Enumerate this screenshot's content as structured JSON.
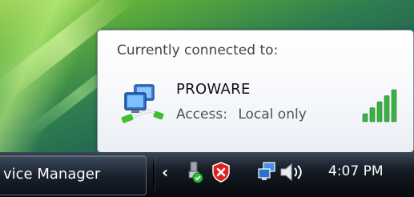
{
  "popup": {
    "title": "Currently connected to:",
    "network_name": "PROWARE",
    "access_label": "Access:",
    "access_value": "Local only",
    "signal_bars_lit": 5,
    "signal_bars_total": 5,
    "signal_color": "#3cb043"
  },
  "taskbar": {
    "task_button_label": "vice Manager",
    "clock": "4:07 PM",
    "tray_icons": [
      "show-hidden-icons-chevron",
      "safely-remove-hardware-icon",
      "security-alert-icon",
      "network-icon",
      "volume-icon"
    ]
  }
}
